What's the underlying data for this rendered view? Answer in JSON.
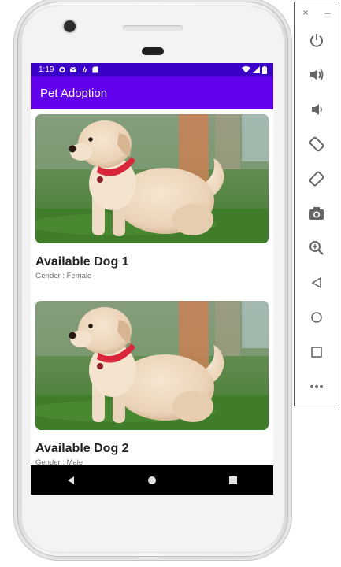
{
  "status_bar": {
    "time": "1:19",
    "icons": [
      "gear-icon",
      "mail-icon",
      "nfc-icon",
      "sd-card-icon",
      "wifi-icon",
      "signal-icon",
      "battery-icon"
    ]
  },
  "app_bar": {
    "title": "Pet Adoption"
  },
  "cards": [
    {
      "title": "Available Dog 1",
      "gender": "Gender : Female"
    },
    {
      "title": "Available Dog 2",
      "gender": "Gender : Male"
    }
  ],
  "nav_bar": {
    "buttons": [
      "back-icon",
      "home-icon",
      "recents-icon"
    ]
  },
  "emulator_panel": {
    "window_controls": [
      "×",
      "–"
    ],
    "buttons": [
      "power-icon",
      "volume-up-icon",
      "volume-down-icon",
      "rotate-left-icon",
      "rotate-right-icon",
      "camera-icon",
      "zoom-icon",
      "back-icon",
      "home-icon",
      "overview-icon",
      "more-icon"
    ]
  },
  "colors": {
    "status_bar": "#3a00c6",
    "app_bar": "#6200ee",
    "collar": "#d8263b"
  }
}
